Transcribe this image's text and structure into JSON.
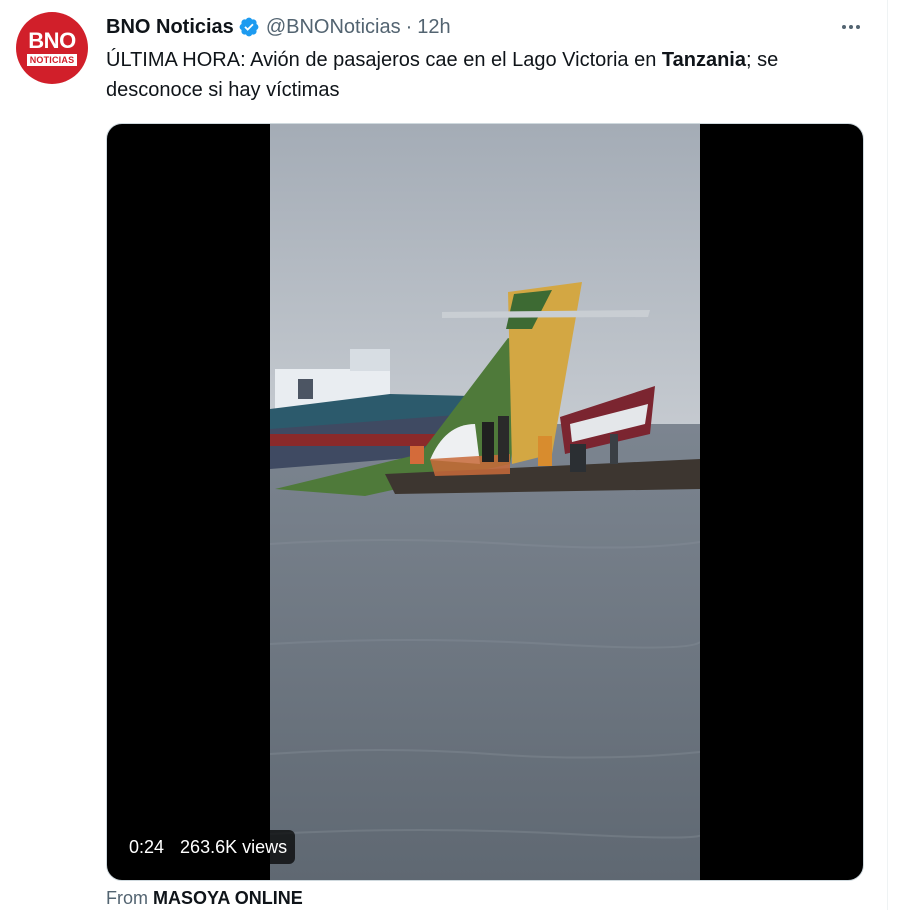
{
  "tweet": {
    "display_name": "BNO Noticias",
    "handle": "@BNONoticias",
    "separator": "·",
    "time": "12h",
    "text_before": "ÚLTIMA HORA: Avión de pasajeros cae en el Lago Victoria en ",
    "text_bold": "Tanzania",
    "text_after": "; se desconoce si hay víctimas",
    "avatar_logo": "BNO",
    "avatar_subtext": "NOTICIAS"
  },
  "video": {
    "duration": "0:24",
    "views": "263.6K views"
  },
  "source": {
    "prefix": "From",
    "name": "MASOYA ONLINE"
  },
  "colors": {
    "verified": "#1d9bf0",
    "secondary_text": "#536471",
    "avatar_red": "#d11f2a"
  }
}
